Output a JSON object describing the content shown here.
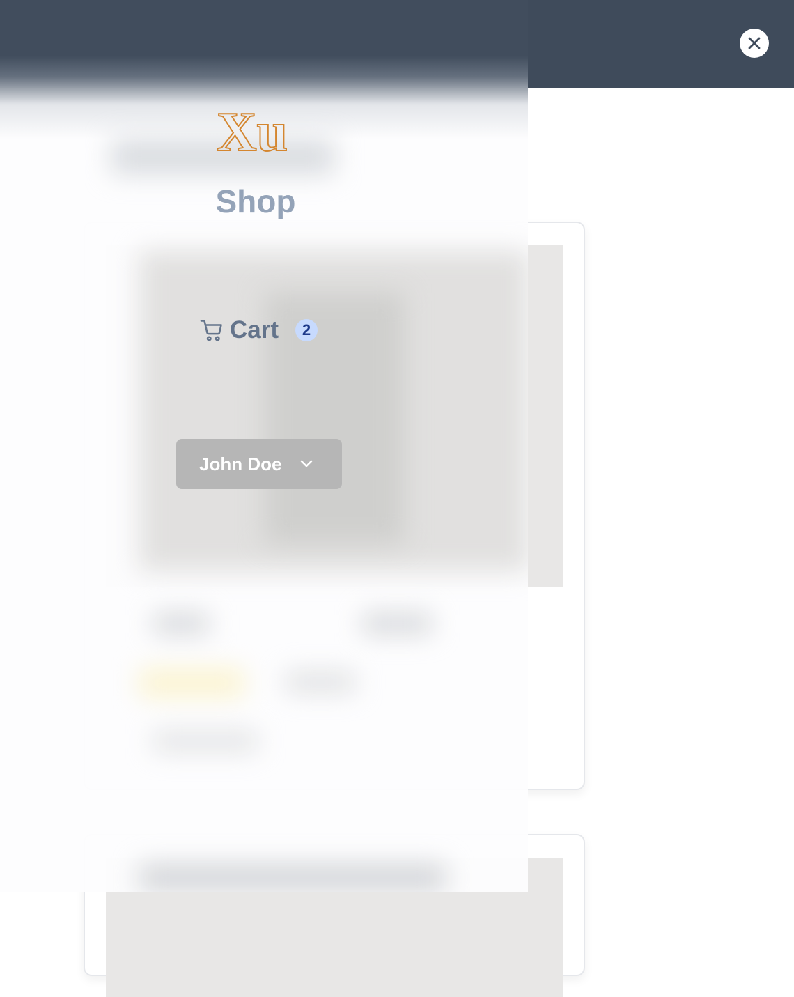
{
  "logo": {
    "text": "Xu",
    "color": "#d4862f"
  },
  "shop_title": "Shop",
  "cart": {
    "label": "Cart",
    "count": "2",
    "icon": "cart-icon"
  },
  "user_menu": {
    "name": "John Doe",
    "icon": "chevron-down-icon"
  },
  "close_button": {
    "icon": "close-icon",
    "text": "X"
  },
  "colors": {
    "topbar": "#3f4b5b",
    "title": "#94a3b8",
    "cart_text": "#64748b",
    "badge_bg": "#c7dafe",
    "badge_text": "#1e3a8a",
    "user_button": "#b6b6b6"
  }
}
